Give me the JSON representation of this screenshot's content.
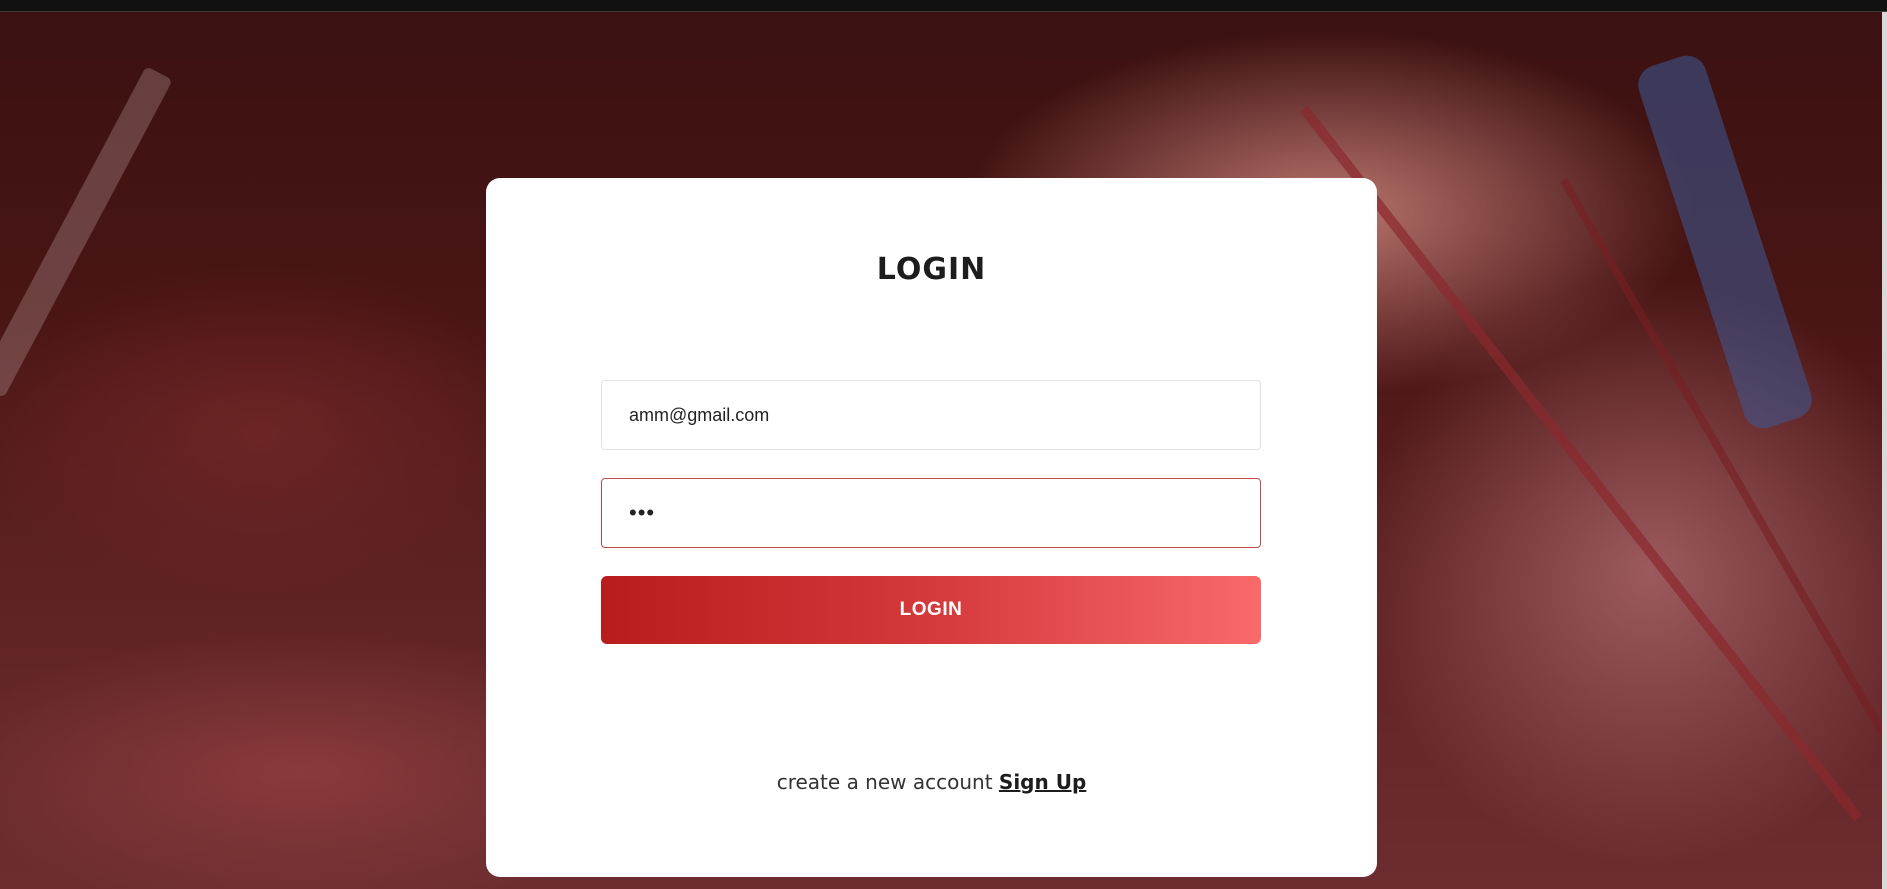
{
  "login_card": {
    "title": "LOGIN",
    "email_value": "amm@gmail.com",
    "password_value": "•••",
    "submit_label": "LOGIN",
    "signup_prompt": "create a new account",
    "signup_link": "Sign Up"
  },
  "colors": {
    "button_gradient_start": "#b91c1c",
    "button_gradient_end": "#f96a6a",
    "focused_border": "#c04a4a",
    "overlay": "#4a1515"
  }
}
